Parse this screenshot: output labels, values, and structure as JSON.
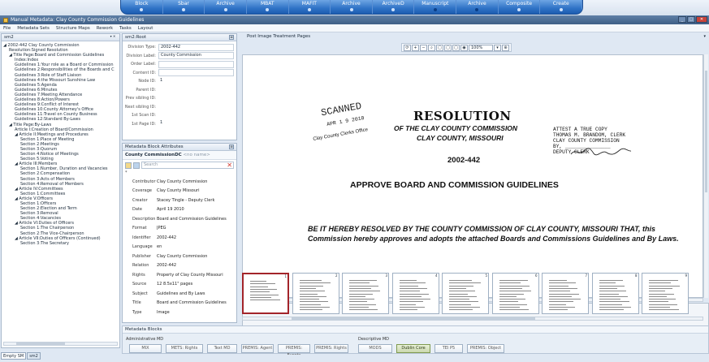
{
  "ribbon": {
    "buttons": [
      {
        "label": "Block",
        "dot": false
      },
      {
        "label": "Sbar",
        "dot": false
      },
      {
        "label": "Archive",
        "dot": false
      },
      {
        "label": "MBAT",
        "dot": false
      },
      {
        "label": "MAFIT",
        "dot": false
      },
      {
        "label": "Archive",
        "dot": false
      },
      {
        "label": "ArchiveD",
        "dot": false
      },
      {
        "label": "Manuscript",
        "dot": true
      },
      {
        "label": "Archive",
        "dot": true
      },
      {
        "label": "Composite",
        "dot": false
      },
      {
        "label": "Create",
        "dot": false
      }
    ]
  },
  "window": {
    "title": "Manual Metadata: Clay County Commission Guidelines",
    "minimize": "_",
    "maximize": "□",
    "close": "✕"
  },
  "menu": [
    "File",
    "Metadata Sets",
    "Structure Maps",
    "Rework",
    "Tasks",
    "Layout"
  ],
  "tree": {
    "header": "sm2",
    "pin": "▾ ✕",
    "items": [
      {
        "text": "◢ 2002-442 Clay County Commission",
        "indent": 0
      },
      {
        "text": "Resolution:Signed Resolution",
        "indent": 1
      },
      {
        "text": "◢ Title Page:Board and Commission Guidelines",
        "indent": 1
      },
      {
        "text": "Index:Index",
        "indent": 2
      },
      {
        "text": "Guidelines 1:Your role as a Board or Commission",
        "indent": 2
      },
      {
        "text": "Guidelines 2:Responsibilities of the Boards and C",
        "indent": 2
      },
      {
        "text": "Guidelines 3:Role of Staff Liaison",
        "indent": 2
      },
      {
        "text": "Guidelines 4:the Missouri Sunshine Law",
        "indent": 2
      },
      {
        "text": "Guidelines 5:Agenda",
        "indent": 2
      },
      {
        "text": "Guidelines 6:Minutes",
        "indent": 2
      },
      {
        "text": "Guidelines 7:Meeting Attendance",
        "indent": 2
      },
      {
        "text": "Guidelines 8:Action/Powers",
        "indent": 2
      },
      {
        "text": "Guidelines 9:Conflict of Interest",
        "indent": 2
      },
      {
        "text": "Guidelines 10:County Attorney's Office",
        "indent": 2
      },
      {
        "text": "Guidelines 11:Travel on County Business",
        "indent": 2
      },
      {
        "text": "Guidelines 12:Standard By-Laws",
        "indent": 2
      },
      {
        "text": "◢ Title Page:By-Laws",
        "indent": 1
      },
      {
        "text": "Article I:Creation of Board/Commission",
        "indent": 2
      },
      {
        "text": "◢ Article II:Meetings and Procedures",
        "indent": 2
      },
      {
        "text": "Section 1:Place of Meeting",
        "indent": 3
      },
      {
        "text": "Section 2:Meetings",
        "indent": 3
      },
      {
        "text": "Section 3:Quorum",
        "indent": 3
      },
      {
        "text": "Section 4:Notice of Meetings",
        "indent": 3
      },
      {
        "text": "Section 5:Voting",
        "indent": 3
      },
      {
        "text": "◢ Article III:Members",
        "indent": 2
      },
      {
        "text": "Section 1:Number, Duration and Vacancies",
        "indent": 3
      },
      {
        "text": "Section 2:Compensation",
        "indent": 3
      },
      {
        "text": "Section 3:Acts of Members",
        "indent": 3
      },
      {
        "text": "Section 4:Removal of Members",
        "indent": 3
      },
      {
        "text": "◢ Article IV:Committees",
        "indent": 2
      },
      {
        "text": "Section 1:Committees",
        "indent": 3
      },
      {
        "text": "◢ Article V:Officers",
        "indent": 2
      },
      {
        "text": "Section 1:Officers",
        "indent": 3
      },
      {
        "text": "Section 2:Election and Term",
        "indent": 3
      },
      {
        "text": "Section 3:Removal",
        "indent": 3
      },
      {
        "text": "Section 4:Vacancies",
        "indent": 3
      },
      {
        "text": "◢ Article VI:Duties of Officers",
        "indent": 2
      },
      {
        "text": "Section 1:The Chairperson",
        "indent": 3
      },
      {
        "text": "Section 2:The Vice-Chairperson",
        "indent": 3
      },
      {
        "text": "◢ Article VII:Duties of Officers (Continued)",
        "indent": 2
      },
      {
        "text": "Section 3:The Secretary",
        "indent": 3
      }
    ]
  },
  "bottom_tabs": [
    "Empty SM",
    "sm2"
  ],
  "struct": {
    "header": "sm2:Root",
    "pin": "⊠",
    "fields": [
      {
        "label": "Division Type:",
        "value": "2002-442",
        "box": true
      },
      {
        "label": "Division Label:",
        "value": "County Commission",
        "box": true
      },
      {
        "label": "Order Label:",
        "value": "",
        "box": true
      },
      {
        "label": "Content ID:",
        "value": "",
        "box": true
      },
      {
        "label": "Node ID:",
        "value": "1",
        "box": false
      },
      {
        "label": "Parent ID:",
        "value": "",
        "box": false
      },
      {
        "label": "Prev sibling ID:",
        "value": "",
        "box": false
      },
      {
        "label": "Next sibling ID:",
        "value": "",
        "box": false
      },
      {
        "label": "1st Scan ID:",
        "value": "",
        "box": false
      },
      {
        "label": "1st Page ID:",
        "value": "1",
        "box": false
      }
    ]
  },
  "mdblock": {
    "header": "Metadata Block Attributes",
    "pin": "⊠",
    "title_main": "County CommissionDC",
    "title_muted": "<no name>",
    "search_placeholder": "Search",
    "search_clear": "✕",
    "star": "*",
    "rows": [
      {
        "key": "Contributor",
        "value": "Clay County Commission"
      },
      {
        "key": "Coverage",
        "value": "Clay County Missouri"
      },
      {
        "key": "Creator",
        "value": "Stacey Tingle - Deputy Clerk"
      },
      {
        "key": "Date",
        "value": "April 19 2010"
      },
      {
        "key": "Description",
        "value": "Board and Commission Guidelines"
      },
      {
        "key": "Format",
        "value": "JPEG"
      },
      {
        "key": "Identifier",
        "value": "2002-442"
      },
      {
        "key": "Language",
        "value": "en"
      },
      {
        "key": "Publisher",
        "value": "Clay County Commission"
      },
      {
        "key": "Relation",
        "value": "2002-442"
      },
      {
        "key": "Rights",
        "value": "Property of Clay County Missouri"
      },
      {
        "key": "Source",
        "value": "12 8.5x11\" pages"
      },
      {
        "key": "Subject",
        "value": "Guidelines and By Laws"
      },
      {
        "key": "Title",
        "value": "Board and Commission Guidelines"
      },
      {
        "key": "Type",
        "value": "Image"
      }
    ]
  },
  "post": {
    "header": "Post Image Treatment Pages",
    "chevron": "▾",
    "toolbar_icons": [
      "⟳",
      "+",
      "−",
      "⌕",
      "▢",
      "▢",
      "▢",
      "◉"
    ],
    "zoom": "100%",
    "zoom_arrow": "▾",
    "zoom_extra": "⊕",
    "document": {
      "stamp": "SCANNED",
      "stamp_date": "APR 1 9  2010",
      "stamp_office": "Clay County Clerks Office",
      "heading": "RESOLUTION",
      "sub1": "OF THE CLAY COUNTY COMMISSION",
      "sub2": "CLAY COUNTY, MISSOURI",
      "number": "2002-442",
      "attest": [
        "ATTEST A TRUE COPY",
        "THOMAS M. BRANDOM, CLERK",
        "CLAY COUNTY COMMISSION",
        "BY, _______________",
        "DEPUTY CLERK"
      ],
      "approve": "APPROVE BOARD AND COMMISSION GUIDELINES",
      "body": "BE IT HEREBY RESOLVED BY THE COUNTY COMMISSION OF CLAY COUNTY, MISSOURI THAT, this Commission hereby approves and adopts the attached Boards and Commissions Guidelines and By Laws."
    },
    "thumbnails": [
      "1",
      "2",
      "3",
      "4",
      "5",
      "6",
      "7",
      "8",
      "9"
    ]
  },
  "metadata_blocks": {
    "header": "Metadata Blocks",
    "admin_label": "Administrative MD",
    "desc_label": "Descriptive MD",
    "admin_buttons": [
      "MIX",
      "METS: Rights",
      "Text MD",
      "PREMIS: Agent",
      "PREMIS: Events",
      "PREMIS: Rights"
    ],
    "desc_buttons": [
      "MODS",
      "Dublin Core",
      "TEI P5",
      "PREMIS: Object"
    ],
    "active": "Dublin Core"
  }
}
